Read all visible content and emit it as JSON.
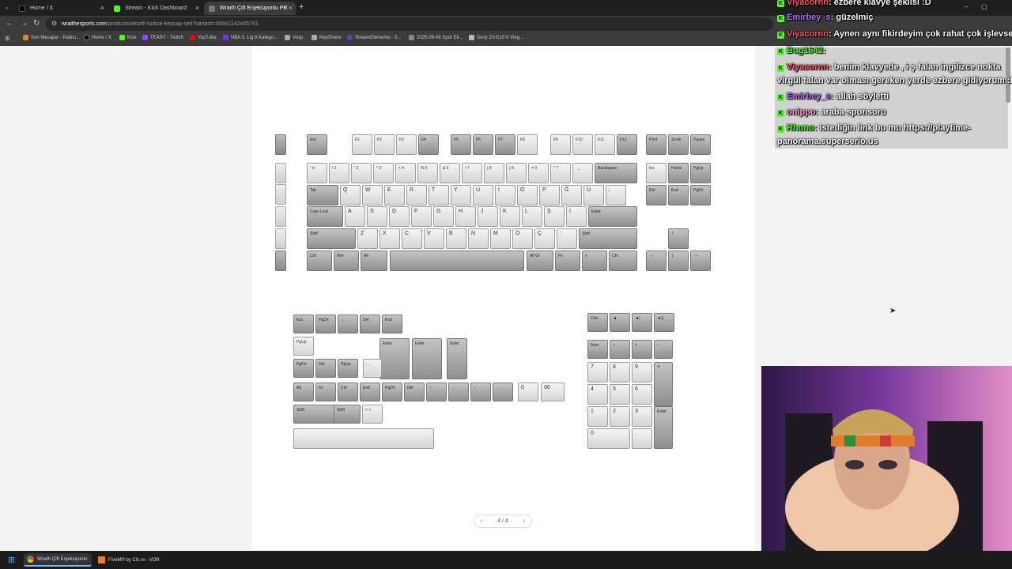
{
  "browser": {
    "tabs": [
      {
        "label": "Home / X",
        "icon": "x-logo-icon"
      },
      {
        "label": "Stream - Kick Dashboard",
        "icon": "kick-logo-icon"
      },
      {
        "label": "Wraith Çift Enjeksiyonlu PBT Tü...",
        "icon": "wraith-logo-icon"
      }
    ],
    "new_tab": "+",
    "url_host": "wraithesports.com",
    "url_path": "/products/wraith-turkce-keycap-seti?variant=48562142445761",
    "bookmarks": [
      "Son Mesajlar - Patlıcı...",
      "Home / X",
      "Kick",
      "TEASY - Twitch",
      "YouTube",
      "NBA 3. Lig 8 Katego...",
      "Vosp",
      "KeyGivers",
      "StreamElements - S...",
      "2025-09-06 Spor Ek...",
      "Sony ZV-E10 II Vlog..."
    ]
  },
  "keyboard": {
    "fn_row": [
      "Esc",
      "F1",
      "F2",
      "F3",
      "F4",
      "F5",
      "F6",
      "F7",
      "F8",
      "F9",
      "F10",
      "F11",
      "F12",
      "Print",
      "Scroll",
      "Pause"
    ],
    "num_row": [
      "\" é",
      "! 1",
      "' 2",
      "^ 3",
      "+ 4",
      "% 5",
      "& 6",
      "/ 7",
      "( 8",
      ") 9",
      "= 0",
      "* ?",
      "- _",
      "Backspace",
      "Ins",
      "Home",
      "PgUp"
    ],
    "q_row": [
      "Tab",
      "Q",
      "W",
      "E",
      "R",
      "T",
      "Y",
      "U",
      "I",
      "O",
      "P",
      "Ğ",
      "Ü",
      ";",
      "Del",
      "End",
      "PgDn"
    ],
    "a_row": [
      "Caps Lock",
      "A",
      "S",
      "D",
      "F",
      "G",
      "H",
      "J",
      "K",
      "L",
      "Ş",
      "İ",
      "Enter"
    ],
    "z_row": [
      "Shift",
      "Z",
      "X",
      "C",
      "V",
      "B",
      "N",
      "M",
      "Ö",
      "Ç",
      ":",
      "Shift",
      "↑"
    ],
    "bottom_row": [
      "Ctrl",
      "Win",
      "Alt",
      "",
      "Alt Gr",
      "Fn",
      "≡",
      "Ctrl",
      "←",
      "↓",
      "→"
    ]
  },
  "extras": {
    "row1": [
      "Esc",
      "PgDn",
      "←",
      "Del",
      "End"
    ],
    "row2": [
      "PgUp",
      "Enter",
      "Enter",
      "Enter"
    ],
    "row3": [
      "PgDn",
      "Del",
      "PgUp",
      "; ,"
    ],
    "row4": [
      "Alt",
      "Fn",
      "Ctrl",
      "End",
      "PgDn",
      "Del",
      "↑",
      "←",
      "↓",
      "→",
      "0",
      "00"
    ],
    "row5": [
      "Shift",
      "Shift",
      "> <"
    ],
    "numpad_top": [
      "Calc",
      "◄",
      "◄)",
      "◄))"
    ],
    "numpad": [
      "Num",
      "÷",
      "×",
      "−",
      "7",
      "8",
      "9",
      "+",
      "4",
      "5",
      "6",
      "1",
      "2",
      "3",
      "Enter",
      "0",
      "."
    ]
  },
  "pager": {
    "prev": "‹",
    "label": "4 / 4",
    "next": "›"
  },
  "chat": [
    {
      "user": "Viyacornn",
      "text": ": ezbere klavye şeklisi :D",
      "color": "#ff4f6d"
    },
    {
      "user": "Emirbey_s",
      "text": ": güzelmiç",
      "color": "#b46cff"
    },
    {
      "user": "Viyacornn",
      "text": ": Aynen aynı fikirdeyim çok rahat çok işlevsel",
      "color": "#ff4f6d"
    },
    {
      "user": "Bug1642",
      "text": ":",
      "color": "#53fc18"
    },
    {
      "user": "Viyacornn",
      "text": ": benim klavyede , i ş falan ingilizce nokta",
      "color": "#ff4f6d"
    },
    {
      "user": "",
      "text": "virgül falan var olması gereken yerde ezbere gidiyorum :D",
      "color": "#fff"
    },
    {
      "user": "Emirbey_s",
      "text": ": allah söyletti",
      "color": "#b46cff"
    },
    {
      "user": "onippo",
      "text": ": araba sponsoru",
      "color": "#ff9bd1"
    },
    {
      "user": "Rhuno",
      "text": ": istediğin link bu mu https://playtime-",
      "color": "#53fc18"
    },
    {
      "user": "",
      "text": "panorama.superserio.us",
      "color": "#fff"
    }
  ],
  "taskbar": [
    {
      "label": "Wraith Çift Enjeksiyonlu",
      "icon": "chrome-icon"
    },
    {
      "label": "FiveM® by Cfx.re - VOR",
      "icon": "fivem-icon"
    }
  ]
}
